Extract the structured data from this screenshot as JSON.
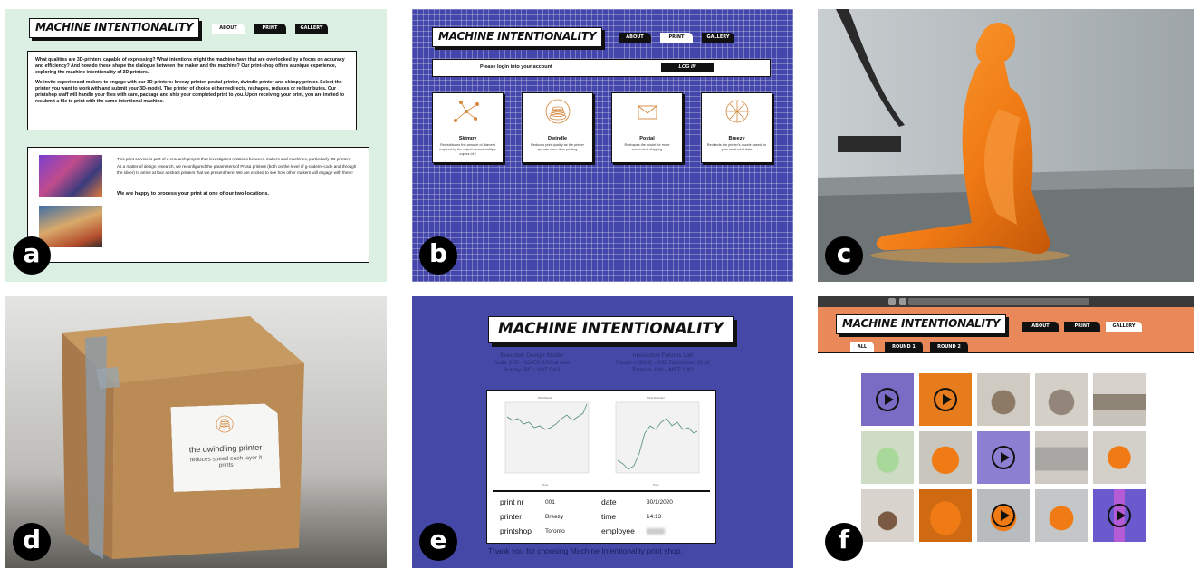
{
  "panel_labels": [
    "a",
    "b",
    "c",
    "d",
    "e",
    "f"
  ],
  "brand": "MACHINE INTENTIONALITY",
  "nav": {
    "about": "ABOUT",
    "print": "PRINT",
    "gallery": "GALLERY"
  },
  "panel_a": {
    "intro_1": "What qualities are 3D-printers capable of expressing? What intentions might the machine have that are overlooked by a focus on accuracy and efficiency? And how do these shape the dialogue between the maker and the machine? Our print-shop offers a unique experience, exploring the machine intentionality of 3D printers.",
    "intro_2": "We invite experienced makers to engage with our 3D-printers: breezy printer, postal printer, dwindle printer and skimpy printer. Select the printer you want to work with and submit your 3D-model. The printer of choice either redirects, reshapes, reduces or redistributes. Our printshop staff will handle your files with care, package and ship your completed print to you. Upon receiving your print, you are invited to resubmit a file to print with the same intentional machine.",
    "research_1": "This print service is part of a research project that investigates relations between makers and machines, particularly 3D printers.",
    "research_2": "As a matter of design research, we reconfigured the parameters of Prusa printers (both on the level of g-code/m-code and through the slicer) to arrive at four abstract printers that we present here. We are excited to see how other makers will engage with them!",
    "locations": "We are happy to process your print at one of our two locations."
  },
  "panel_b": {
    "login_prompt": "Please login into your account",
    "login_button": "LOG IN",
    "printers": [
      {
        "name": "Skimpy",
        "desc": "Redistributes the amount of filament required by the object across multiple copies of it"
      },
      {
        "name": "Dwindle",
        "desc": "Reduces print quality as the printer spends more time printing"
      },
      {
        "name": "Postal",
        "desc": "Reshapes the model for more convenient shipping"
      },
      {
        "name": "Breezy",
        "desc": "Redirects the printer's nozzle based on your local wind data"
      }
    ]
  },
  "panel_d": {
    "sticker_title": "the dwindling printer",
    "sticker_sub": "reduces speed each layer it prints"
  },
  "panel_e": {
    "location_1": [
      "Everyday Design Studio",
      "Suite 250 - 13450 102nd Ave",
      "Surrey, BC - V3T 0A3"
    ],
    "location_2": [
      "Interactive Futures Lab",
      "Room # 802C - 205 Richmond St W",
      "Toronto, ON - M5T 1W1"
    ],
    "chart_titles": [
      "Wind Bearin",
      "Wind Direction"
    ],
    "chart_xlabel": "Time",
    "receipt": {
      "print_nr_label": "print nr",
      "print_nr": "001",
      "date_label": "date",
      "date": "30/1/2020",
      "printer_label": "printer",
      "printer": "Breezy",
      "time_label": "time",
      "time": "14:13",
      "printshop_label": "printshop",
      "printshop": "Toronto",
      "employee_label": "employee"
    },
    "thanks": "Thank you for choosing Machine Intentionality print shop."
  },
  "panel_f": {
    "tabs": [
      "ALL",
      "ROUND 1",
      "ROUND 2"
    ]
  }
}
